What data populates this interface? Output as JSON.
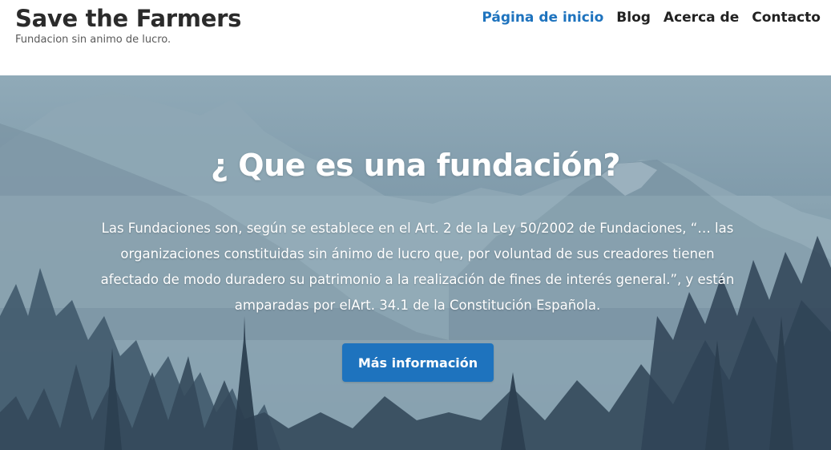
{
  "site": {
    "title": "Save the Farmers",
    "tagline": "Fundacion sin animo de lucro."
  },
  "nav": {
    "items": [
      {
        "label": "Página de inicio",
        "active": true
      },
      {
        "label": "Blog",
        "active": false
      },
      {
        "label": "Acerca de",
        "active": false
      },
      {
        "label": "Contacto",
        "active": false
      }
    ]
  },
  "hero": {
    "title": "¿ Que es una fundación?",
    "text": "Las Fundaciones son, según se establece en el Art. 2 de la Ley 50/2002 de Fundaciones, “… las organizaciones constituidas sin ánimo de lucro que, por voluntad de sus creadores tienen afectado de modo duradero su patrimonio a la realización de fines de interés general.”, y están amparadas por elArt. 34.1 de la Constitución Española.",
    "button_label": "Más información",
    "background": "mountain-forest-landscape"
  },
  "colors": {
    "accent": "#1e73be",
    "text_dark": "#2b2b2b",
    "hero_sky": "#90aab8"
  }
}
